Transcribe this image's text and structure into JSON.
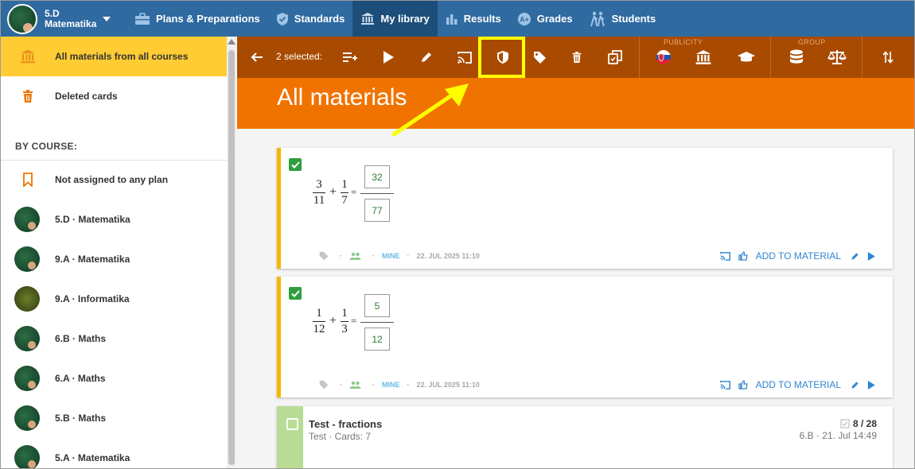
{
  "course": {
    "line1": "5.D",
    "line2": "Matematika"
  },
  "nav": [
    {
      "label": "Plans & Preparations",
      "icon": "briefcase-icon"
    },
    {
      "label": "Standards",
      "icon": "shield-check-icon"
    },
    {
      "label": "My library",
      "icon": "library-icon",
      "active": true
    },
    {
      "label": "Results",
      "icon": "bar-chart-icon"
    },
    {
      "label": "Grades",
      "icon": "grades-icon"
    },
    {
      "label": "Students",
      "icon": "students-icon"
    }
  ],
  "sidebar": {
    "all_materials": "All materials from all courses",
    "deleted": "Deleted cards",
    "by_course_heading": "BY COURSE:",
    "not_assigned": "Not assigned to any plan",
    "courses": [
      "5.D · Matematika",
      "9.A · Matematika",
      "9.A · Informatika",
      "6.B · Maths",
      "6.A · Maths",
      "5.B · Maths",
      "5.A · Matematika"
    ]
  },
  "toolbar": {
    "selected_text": "2 selected:",
    "publicity_label": "PUBLICITY",
    "group_label": "GROUP"
  },
  "banner": {
    "title": "All materials"
  },
  "cards": [
    {
      "n1": "3",
      "d1": "11",
      "op": "+",
      "n2": "1",
      "d2": "7",
      "eq": "=",
      "ans_num": "32",
      "ans_den": "77",
      "owner": "MINE",
      "date": "22. JUL 2025 11:10",
      "add_label": "ADD TO MATERIAL"
    },
    {
      "n1": "1",
      "d1": "12",
      "op": "+",
      "n2": "1",
      "d2": "3",
      "eq": "=",
      "ans_num": "5",
      "ans_den": "12",
      "owner": "MINE",
      "date": "22. JUL 2025 11:10",
      "add_label": "ADD TO MATERIAL"
    }
  ],
  "test": {
    "title": "Test - fractions",
    "subtitle": "Test · Cards: 7",
    "count": "8 / 28",
    "class_date": "6.B · 21. Jul 14:49"
  },
  "colors": {
    "nav_bg": "#2f6aa0",
    "toolbar_bg": "#a84b00",
    "banner_bg": "#f07300",
    "selected_item": "#ffcc33",
    "highlight": "#ffff00",
    "card_accent": "#f5b800"
  }
}
